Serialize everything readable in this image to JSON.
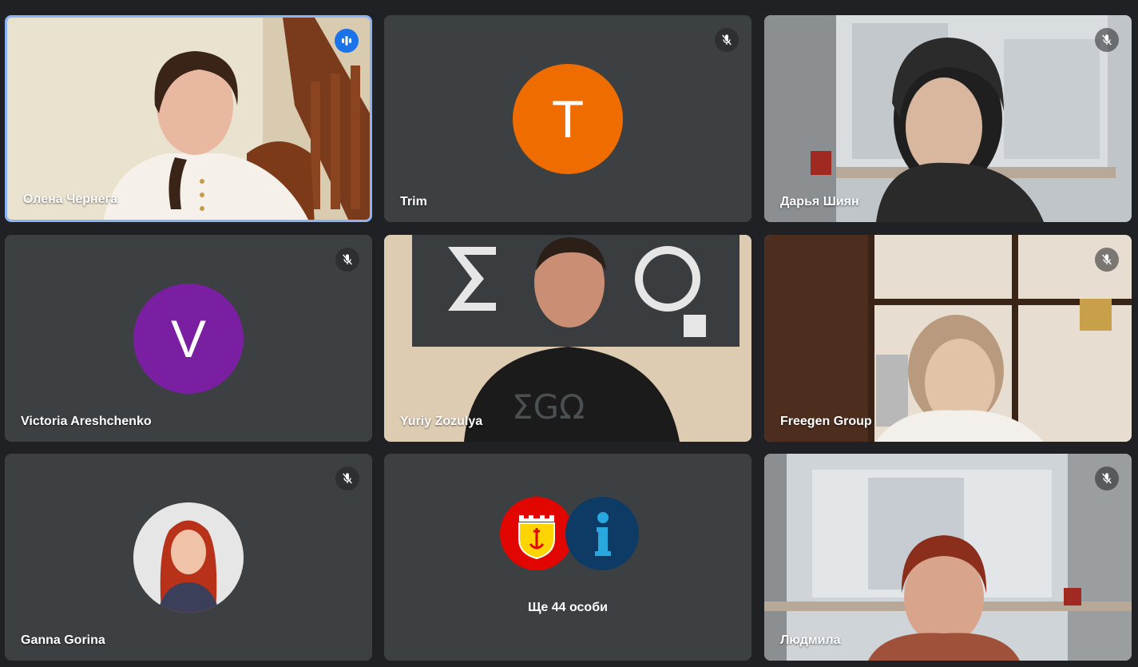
{
  "participants": [
    {
      "name": "Олена Чернега",
      "state": "speaking",
      "type": "video"
    },
    {
      "name": "Trim",
      "state": "muted",
      "type": "avatar",
      "initial": "T",
      "color": "#ef6c00"
    },
    {
      "name": "Дарья Шиян",
      "state": "muted",
      "type": "video"
    },
    {
      "name": "Victoria Areshchenko",
      "state": "muted",
      "type": "avatar",
      "initial": "V",
      "color": "#7b1fa2"
    },
    {
      "name": "Yuriy Zozulya",
      "state": "unmuted",
      "type": "video"
    },
    {
      "name": "Freegen Group",
      "state": "muted",
      "type": "video"
    },
    {
      "name": "Ganna Gorina",
      "state": "muted",
      "type": "photo-avatar"
    },
    {
      "name": "Людмила",
      "state": "muted",
      "type": "video"
    }
  ],
  "overflow": {
    "label": "Ще 44 особи",
    "avatars": [
      {
        "icon": "city-coat-of-arms-icon",
        "color": "#e10600"
      },
      {
        "icon": "info-i-icon",
        "color": "#0d3b66"
      }
    ]
  },
  "colors": {
    "background": "#202124",
    "tile": "#3c4043",
    "active_border": "#8ab4f8",
    "speaking_badge": "#1a73e8"
  }
}
